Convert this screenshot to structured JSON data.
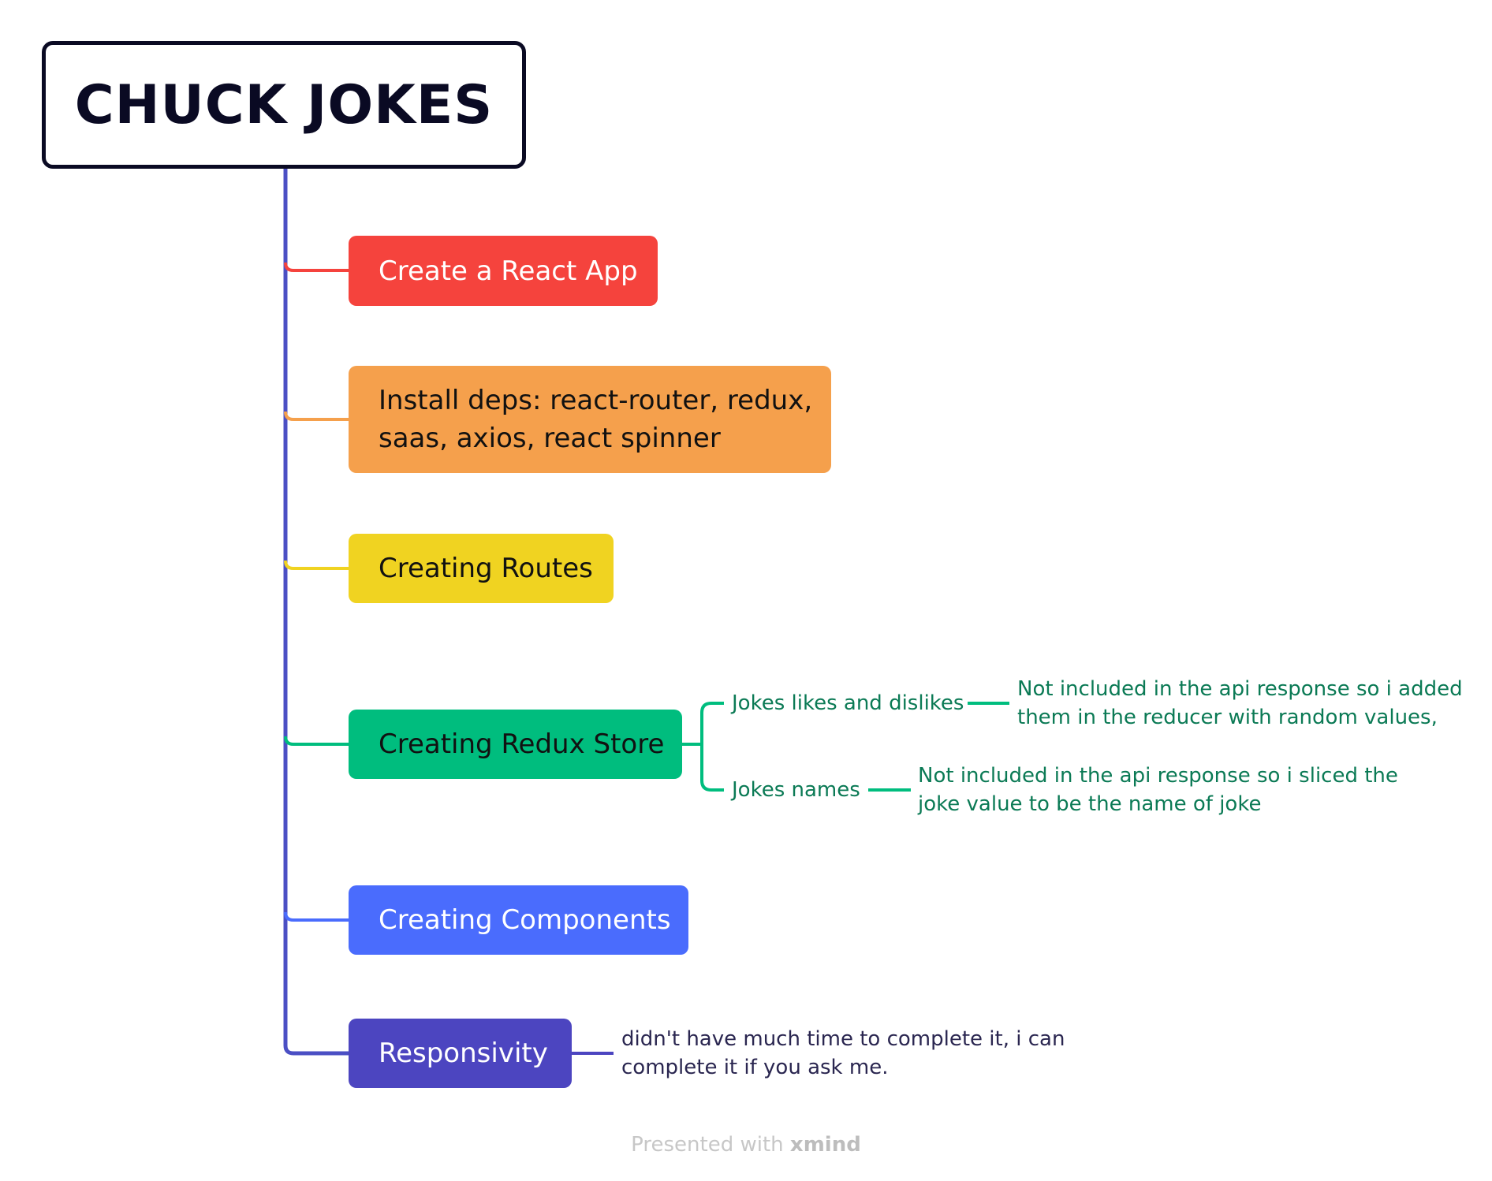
{
  "title": "CHUCK JOKES",
  "colors": {
    "trunk": "#4b4fc4",
    "react_app": "#f5433d",
    "install_deps": "#f5a04c",
    "routes": "#f0d321",
    "redux": "#00bd7e",
    "components": "#4a6cfd",
    "responsivity": "#4c45c0"
  },
  "nodes": {
    "react_app": "Create a React App",
    "install_deps_line1": "Install deps:  react-router, redux,",
    "install_deps_line2": "saas, axios, react spinner",
    "routes": "Creating Routes",
    "redux": "Creating Redux Store",
    "components": "Creating Components",
    "responsivity": "Responsivity"
  },
  "redux_children": {
    "likes": {
      "label": "Jokes likes and dislikes",
      "note_line1": "Not included in the api response so i added",
      "note_line2": "them in the reducer with random values,"
    },
    "names": {
      "label": "Jokes names",
      "note_line1": "Not included in the api response so i sliced the",
      "note_line2": "joke value to be the name of joke"
    }
  },
  "responsivity_note": {
    "line1": "didn't have much time to complete it, i can",
    "line2": "complete it if you ask me."
  },
  "footer": {
    "prefix": "Presented with",
    "brand": "xmind"
  }
}
